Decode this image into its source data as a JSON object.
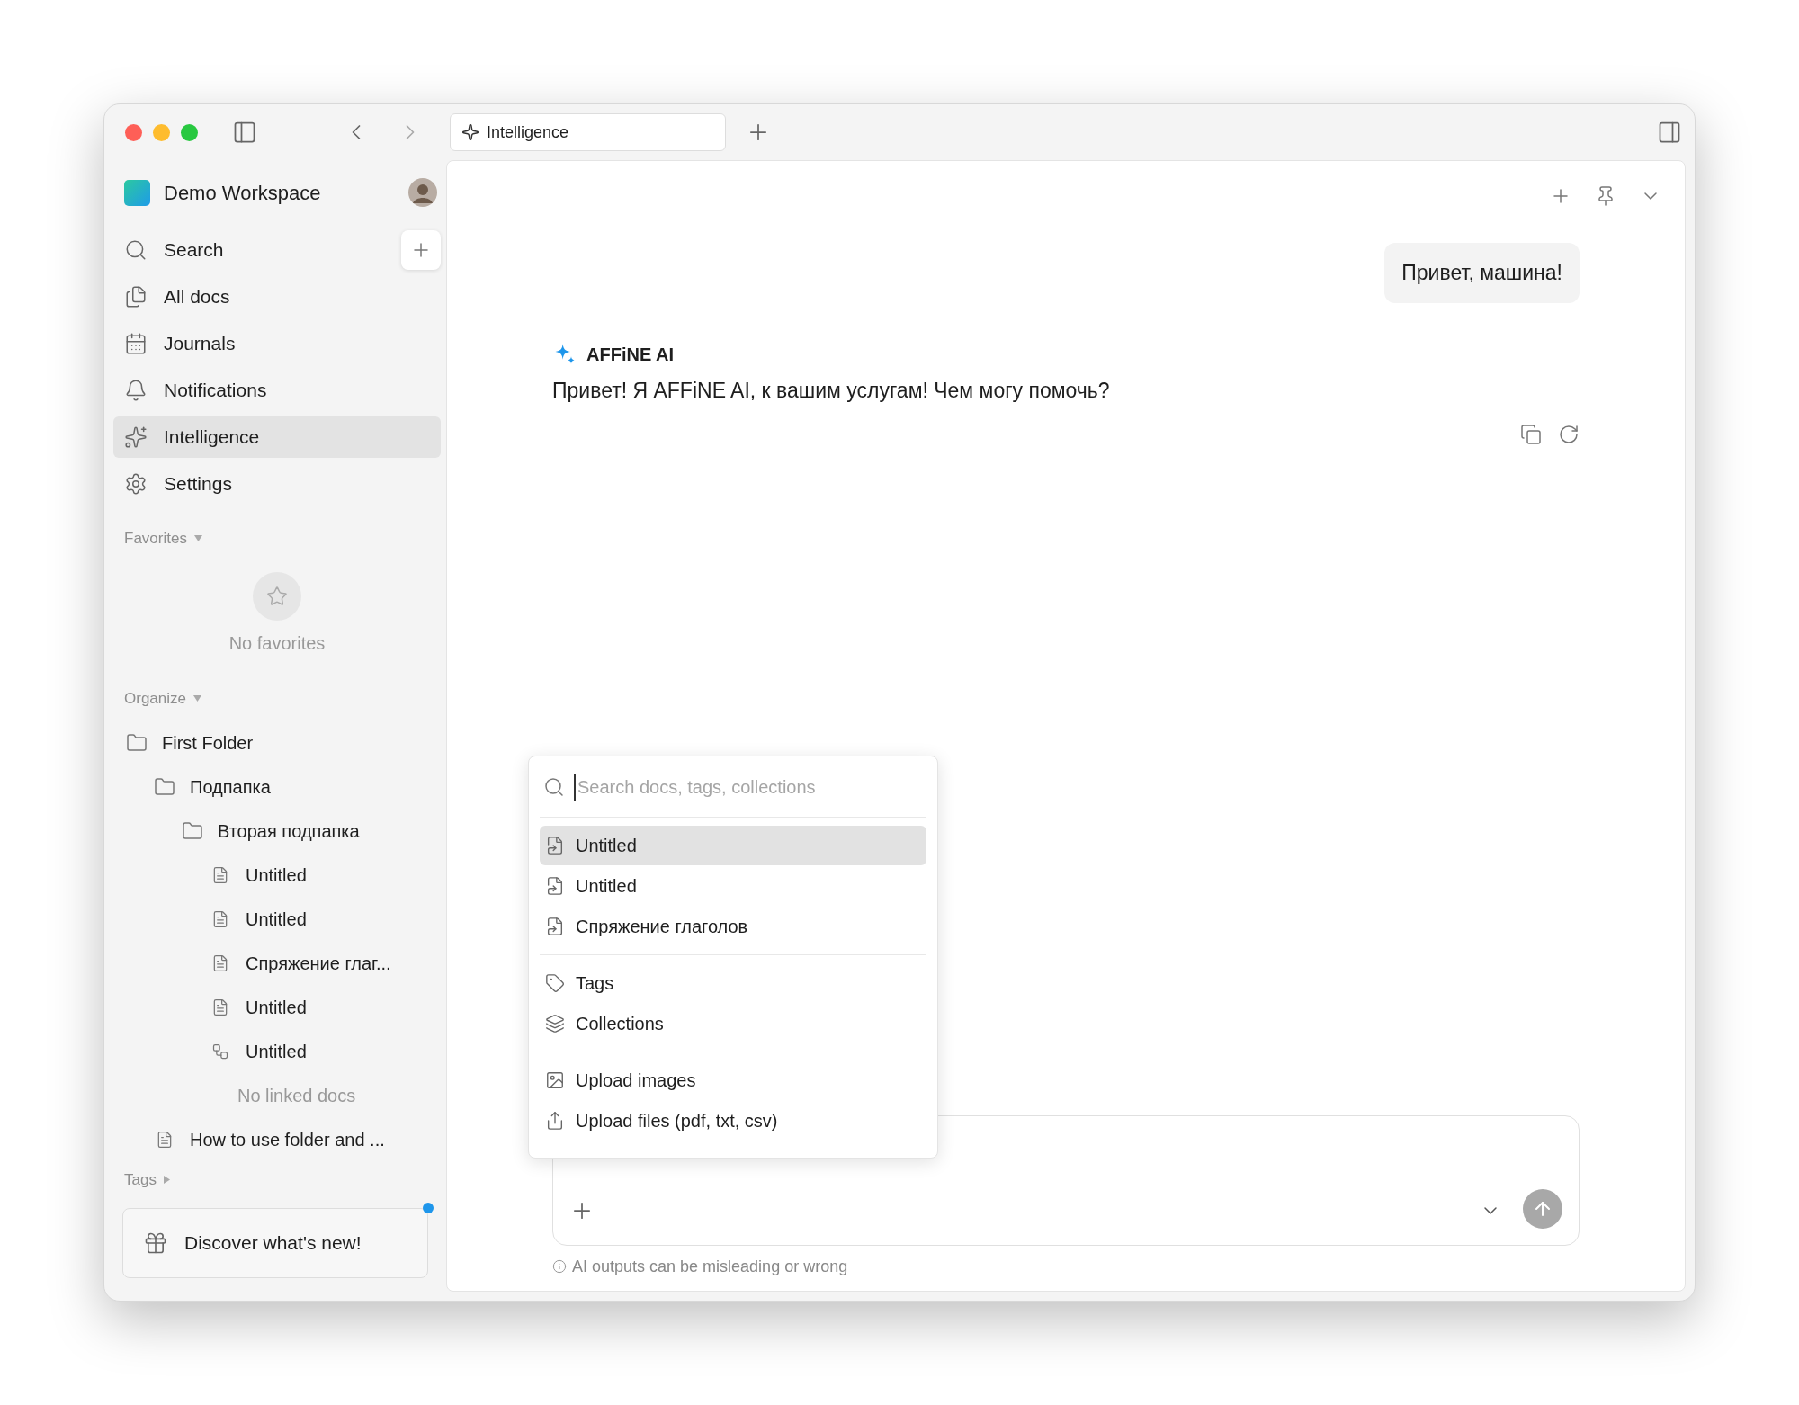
{
  "window": {
    "tabs": [
      {
        "label": "Intelligence",
        "selected": true
      }
    ]
  },
  "sidebar": {
    "workspace": "Demo Workspace",
    "nav": [
      {
        "label": "Search",
        "selected": false
      },
      {
        "label": "All docs",
        "selected": false
      },
      {
        "label": "Journals",
        "selected": false
      },
      {
        "label": "Notifications",
        "selected": false
      },
      {
        "label": "Intelligence",
        "selected": true
      },
      {
        "label": "Settings",
        "selected": false
      }
    ],
    "favorites": {
      "label": "Favorites",
      "empty": "No favorites"
    },
    "organize": {
      "label": "Organize",
      "tree": [
        {
          "label": "First Folder",
          "kind": "folder",
          "children": [
            {
              "label": "Подпапка",
              "kind": "folder",
              "children": [
                {
                  "label": "Вторая подпапка",
                  "kind": "folder",
                  "children": [
                    {
                      "label": "Untitled",
                      "kind": "doc"
                    },
                    {
                      "label": "Untitled",
                      "kind": "doc"
                    },
                    {
                      "label": "Спряжение глаг...",
                      "kind": "doc"
                    },
                    {
                      "label": "Untitled",
                      "kind": "doc"
                    },
                    {
                      "label": "Untitled",
                      "kind": "edgeless",
                      "children": [
                        {
                          "label": "No linked docs",
                          "kind": "empty"
                        }
                      ]
                    }
                  ]
                }
              ]
            },
            {
              "label": "How to use folder and ...",
              "kind": "doc"
            }
          ]
        }
      ]
    },
    "tags": {
      "label": "Tags"
    },
    "discover": {
      "label": "Discover what's new!",
      "unread": true
    }
  },
  "chat": {
    "user_message": "Привет, машина!",
    "assistant": {
      "author": "AFFiNE AI",
      "text": "Привет! Я AFFiNE AI, к вашим услугам! Чем могу помочь?"
    },
    "disclaimer": "AI outputs can be misleading or wrong"
  },
  "popup": {
    "placeholder": "Search docs, tags, collections",
    "groups": [
      [
        {
          "label": "Untitled",
          "kind": "doc",
          "selected": true
        },
        {
          "label": "Untitled",
          "kind": "doc",
          "selected": false
        },
        {
          "label": "Спряжение глаголов",
          "kind": "doc",
          "selected": false
        }
      ],
      [
        {
          "label": "Tags",
          "kind": "tags",
          "selected": false
        },
        {
          "label": "Collections",
          "kind": "collections",
          "selected": false
        }
      ],
      [
        {
          "label": "Upload images",
          "kind": "images",
          "selected": false
        },
        {
          "label": "Upload files (pdf, txt, csv)",
          "kind": "files",
          "selected": false
        }
      ]
    ]
  }
}
